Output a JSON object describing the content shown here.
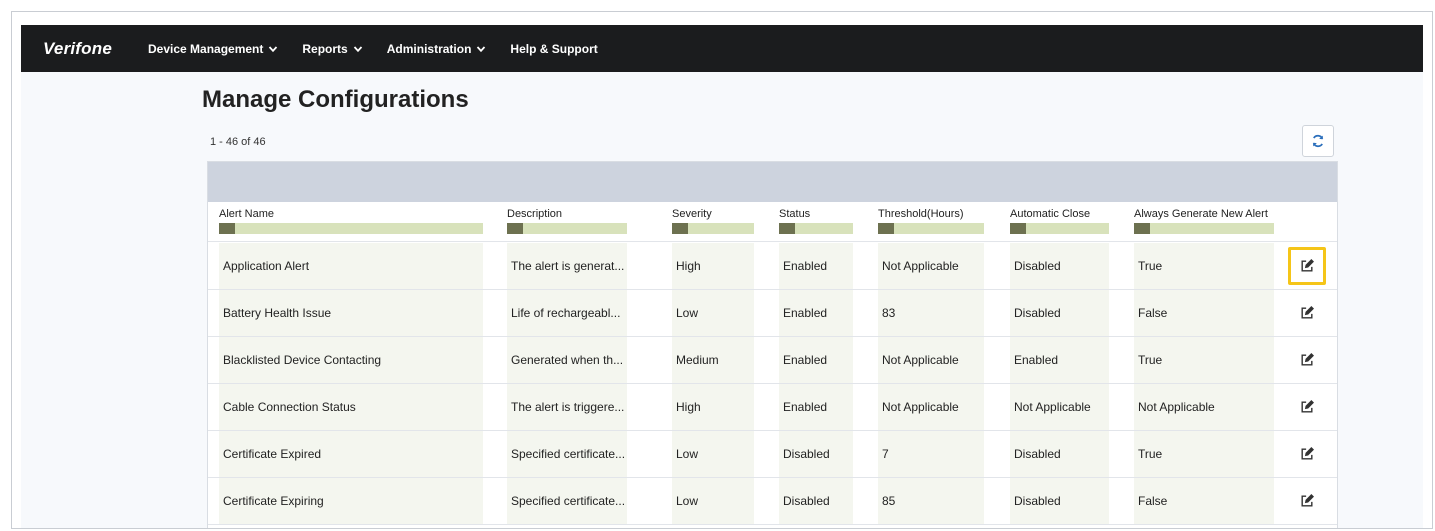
{
  "nav": {
    "logo": "Verifone",
    "items": [
      {
        "label": "Device Management",
        "dropdown": true
      },
      {
        "label": "Reports",
        "dropdown": true
      },
      {
        "label": "Administration",
        "dropdown": true
      },
      {
        "label": "Help & Support",
        "dropdown": false
      }
    ]
  },
  "page": {
    "title": "Manage Configurations",
    "count": "1 - 46 of 46",
    "refresh_icon": "refresh-icon"
  },
  "table": {
    "columns": [
      "Alert Name",
      "Description",
      "Severity",
      "Status",
      "Threshold(Hours)",
      "Automatic Close",
      "Always Generate New Alert"
    ],
    "rows": [
      [
        "Application Alert",
        "The alert is generat...",
        "High",
        "Enabled",
        "Not Applicable",
        "Disabled",
        "True"
      ],
      [
        "Battery Health Issue",
        "Life of rechargeabl...",
        "Low",
        "Enabled",
        "83",
        "Disabled",
        "False"
      ],
      [
        "Blacklisted Device Contacting",
        "Generated when th...",
        "Medium",
        "Enabled",
        "Not Applicable",
        "Enabled",
        "True"
      ],
      [
        "Cable Connection Status",
        "The alert is triggere...",
        "High",
        "Enabled",
        "Not Applicable",
        "Not Applicable",
        "Not Applicable"
      ],
      [
        "Certificate Expired",
        "Specified certificate...",
        "Low",
        "Disabled",
        "7",
        "Disabled",
        "True"
      ],
      [
        "Certificate Expiring",
        "Specified certificate...",
        "Low",
        "Disabled",
        "85",
        "Disabled",
        "False"
      ]
    ],
    "highlighted_row": 0
  },
  "colors": {
    "navbar_bg": "#1b1c1e",
    "table_band": "#cdd3de",
    "highlight": "#f5c518",
    "refresh_icon": "#2a6ebb"
  }
}
